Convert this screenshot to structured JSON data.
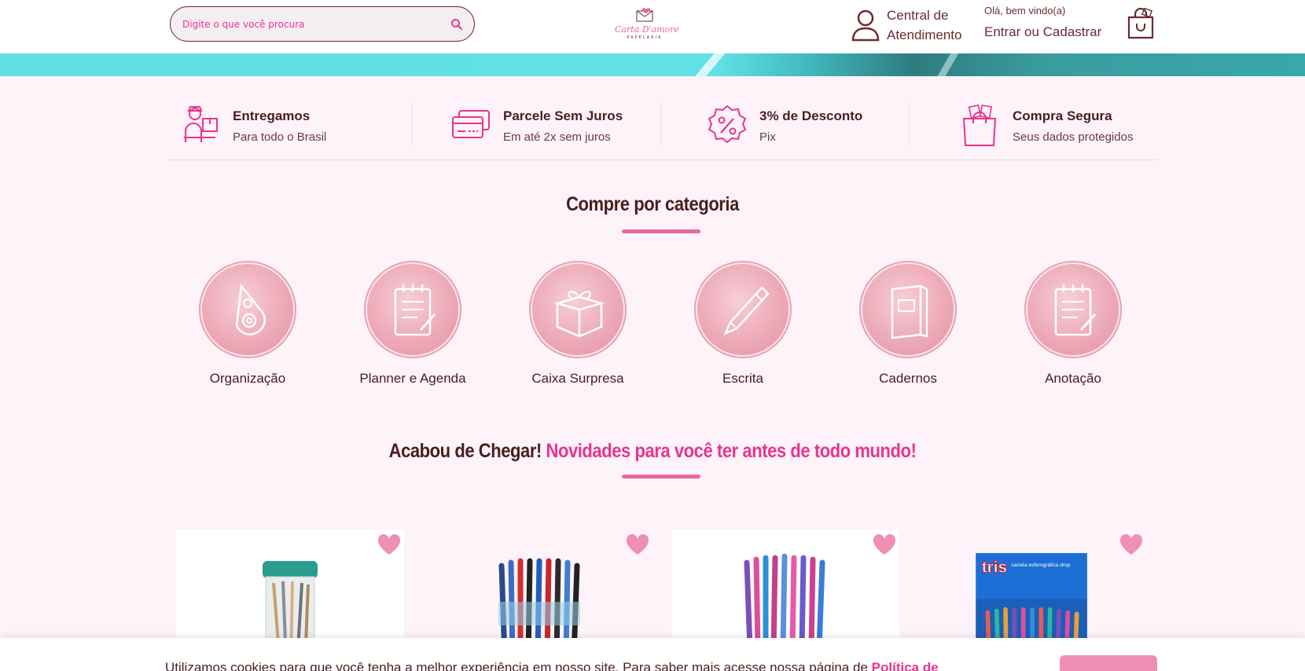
{
  "header": {
    "search_placeholder": "Digite o que você procura",
    "logo_text": "Carta D'amore",
    "logo_sub": "PAPELARIA",
    "central_label": "Central de Atendimento",
    "greeting": "Olá, bem vindo(a)",
    "login_label": "Entrar ou Cadastrar"
  },
  "benefits": [
    {
      "title": "Entregamos",
      "subtitle": "Para todo o Brasil",
      "icon": "delivery-icon"
    },
    {
      "title": "Parcele Sem Juros",
      "subtitle": "Em até 2x sem juros",
      "icon": "credit-card-icon"
    },
    {
      "title": "3% de Desconto",
      "subtitle": "Pix",
      "icon": "discount-icon"
    },
    {
      "title": "Compra Segura",
      "subtitle": "Seus dados protegidos",
      "icon": "secure-bag-icon"
    }
  ],
  "categories_section": {
    "title": "Compre por categoria",
    "items": [
      {
        "label": "Organização",
        "icon": "correction-tape-icon"
      },
      {
        "label": "Planner e Agenda",
        "icon": "notepad-icon"
      },
      {
        "label": "Caixa Surpresa",
        "icon": "gift-box-icon"
      },
      {
        "label": "Escrita",
        "icon": "pen-icon"
      },
      {
        "label": "Cadernos",
        "icon": "notebook-icon"
      },
      {
        "label": "Anotação",
        "icon": "notepad-icon"
      }
    ]
  },
  "new_section": {
    "title_part1": "Acabou de Chegar!",
    "title_part2": "Novidades para você ter antes de todo mundo!"
  },
  "products": [
    {
      "image": "pen-jar-product",
      "favorite_icon": "heart-icon"
    },
    {
      "image": "ballpoint-pens-product",
      "favorite_icon": "heart-icon"
    },
    {
      "image": "colored-pens-display-product",
      "favorite_icon": "heart-icon"
    },
    {
      "image": "tris-drop-pens-box-product",
      "brand_text": "tris",
      "box_text": "caneta esferográfica drop",
      "favorite_icon": "heart-icon"
    }
  ],
  "cookie": {
    "text": "Utilizamos cookies para que você tenha a melhor experiência em nosso site. Para saber mais acesse nossa página de ",
    "link": "Política de"
  },
  "colors": {
    "brand_pink": "#e8348f",
    "brand_brown": "#4a1d1d",
    "background": "#fdf3f8",
    "banner_teal": "#5fe0e4",
    "heart_pink": "#ef8fb5"
  }
}
